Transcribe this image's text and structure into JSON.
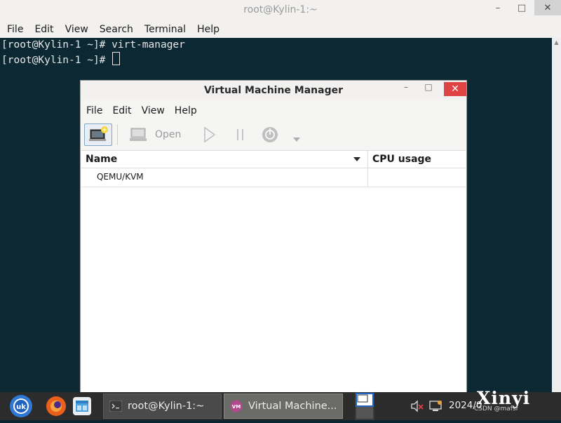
{
  "terminal": {
    "title": "root@Kylin-1:~",
    "controls": {
      "minimize": "–",
      "maximize": "□",
      "close": "✕"
    },
    "menu": [
      "File",
      "Edit",
      "View",
      "Search",
      "Terminal",
      "Help"
    ],
    "lines": [
      "[root@Kylin-1 ~]# virt-manager",
      "[root@Kylin-1 ~]# "
    ]
  },
  "vmm": {
    "title": "Virtual Machine Manager",
    "controls": {
      "minimize": "–",
      "maximize": "□",
      "close": "✕"
    },
    "menu": [
      "File",
      "Edit",
      "View",
      "Help"
    ],
    "toolbar": {
      "open_label": "Open"
    },
    "columns": {
      "name": "Name",
      "cpu": "CPU usage"
    },
    "rows": [
      {
        "name": "QEMU/KVM",
        "cpu": ""
      }
    ]
  },
  "taskbar": {
    "tasks": [
      {
        "label": "root@Kylin-1:~"
      },
      {
        "label": "Virtual Machine..."
      }
    ],
    "clock": "2024/0",
    "watermark": "Xinyi",
    "watermark_sub": "CSDN @mafsf"
  },
  "colors": {
    "terminal_bg": "#0b2833",
    "close_red": "#e04343",
    "taskbar_bg": "#2c2c2c"
  }
}
